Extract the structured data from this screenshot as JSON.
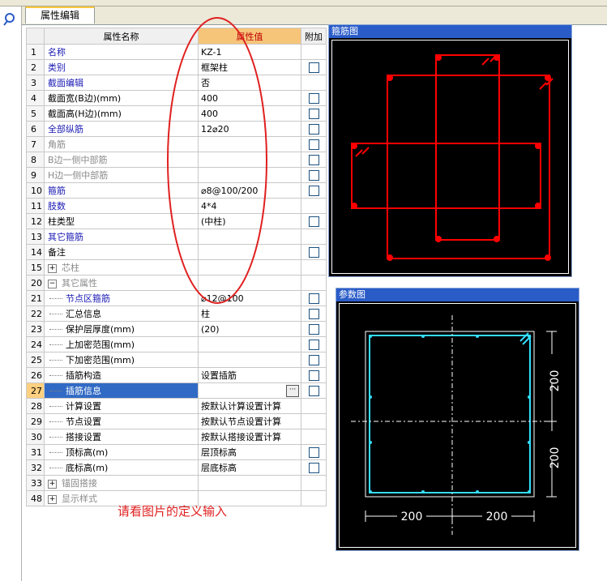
{
  "tab_label": "属性编辑",
  "columns": {
    "index": "",
    "name": "属性名称",
    "value": "属性值",
    "extra": "附加"
  },
  "rows": [
    {
      "n": "1",
      "name": "名称",
      "value": "KZ-1",
      "style": "blue",
      "cb": false
    },
    {
      "n": "2",
      "name": "类别",
      "value": "框架柱",
      "style": "blue",
      "cb": true
    },
    {
      "n": "3",
      "name": "截面编辑",
      "value": "否",
      "style": "blue",
      "cb": false
    },
    {
      "n": "4",
      "name": "截面宽(B边)(mm)",
      "value": "400",
      "style": "blk",
      "cb": true
    },
    {
      "n": "5",
      "name": "截面高(H边)(mm)",
      "value": "400",
      "style": "blk",
      "cb": true
    },
    {
      "n": "6",
      "name": "全部纵筋",
      "value": "12⌀20",
      "style": "blue",
      "cb": true
    },
    {
      "n": "7",
      "name": "角筋",
      "value": "",
      "style": "gray",
      "cb": true
    },
    {
      "n": "8",
      "name": "B边一侧中部筋",
      "value": "",
      "style": "gray",
      "cb": true
    },
    {
      "n": "9",
      "name": "H边一侧中部筋",
      "value": "",
      "style": "gray",
      "cb": true
    },
    {
      "n": "10",
      "name": "箍筋",
      "value": "⌀8@100/200",
      "style": "blue",
      "cb": true
    },
    {
      "n": "11",
      "name": "肢数",
      "value": "4*4",
      "style": "blue",
      "cb": false
    },
    {
      "n": "12",
      "name": "柱类型",
      "value": "(中柱)",
      "style": "blk",
      "cb": true
    },
    {
      "n": "13",
      "name": "其它箍筋",
      "value": "",
      "style": "blue",
      "cb": false
    },
    {
      "n": "14",
      "name": "备注",
      "value": "",
      "style": "blk",
      "cb": true
    },
    {
      "n": "15",
      "name": "芯柱",
      "value": "",
      "style": "gray",
      "cb": false,
      "exp": "+"
    },
    {
      "n": "20",
      "name": "其它属性",
      "value": "",
      "style": "gray",
      "cb": false,
      "exp": "−"
    },
    {
      "n": "21",
      "name": "节点区箍筋",
      "value": "⌀12@100",
      "style": "blue",
      "cb": true,
      "tree": true
    },
    {
      "n": "22",
      "name": "汇总信息",
      "value": "柱",
      "style": "blk",
      "cb": true,
      "tree": true
    },
    {
      "n": "23",
      "name": "保护层厚度(mm)",
      "value": "(20)",
      "style": "blk",
      "cb": true,
      "tree": true
    },
    {
      "n": "24",
      "name": "上加密范围(mm)",
      "value": "",
      "style": "blk",
      "cb": true,
      "tree": true
    },
    {
      "n": "25",
      "name": "下加密范围(mm)",
      "value": "",
      "style": "blk",
      "cb": true,
      "tree": true
    },
    {
      "n": "26",
      "name": "插筋构造",
      "value": "设置插筋",
      "style": "blk",
      "cb": true,
      "tree": true
    },
    {
      "n": "27",
      "name": "插筋信息",
      "value": "",
      "style": "blk",
      "cb": true,
      "tree": true,
      "selected": true
    },
    {
      "n": "28",
      "name": "计算设置",
      "value": "按默认计算设置计算",
      "style": "blk",
      "cb": false,
      "tree": true
    },
    {
      "n": "29",
      "name": "节点设置",
      "value": "按默认节点设置计算",
      "style": "blk",
      "cb": false,
      "tree": true
    },
    {
      "n": "30",
      "name": "搭接设置",
      "value": "按默认搭接设置计算",
      "style": "blk",
      "cb": false,
      "tree": true
    },
    {
      "n": "31",
      "name": "顶标高(m)",
      "value": "层顶标高",
      "style": "blk",
      "cb": true,
      "tree": true
    },
    {
      "n": "32",
      "name": "底标高(m)",
      "value": "层底标高",
      "style": "blk",
      "cb": true,
      "tree": true
    },
    {
      "n": "33",
      "name": "锚固搭接",
      "value": "",
      "style": "gray",
      "cb": false,
      "exp": "+"
    },
    {
      "n": "48",
      "name": "显示样式",
      "value": "",
      "style": "gray",
      "cb": false,
      "exp": "+"
    }
  ],
  "note": "请看图片的定义输入",
  "stirrup_panel": {
    "title": "箍筋图",
    "color": "#ff0000"
  },
  "param_panel": {
    "title": "参数图",
    "color": "#33ddff",
    "dim_right_top": "200",
    "dim_right_bottom": "200",
    "dim_bottom_left": "200",
    "dim_bottom_right": "200"
  },
  "annotation_color": "#e02020"
}
